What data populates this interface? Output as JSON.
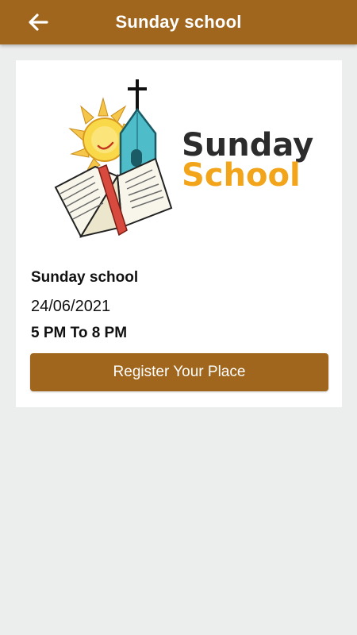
{
  "app_bar": {
    "title": "Sunday school",
    "back_icon": "arrow-left-icon"
  },
  "event": {
    "image": {
      "logo_line1": "Sunday",
      "logo_line2": "School",
      "logo_line1_color": "#2c2c2c",
      "logo_line2_color": "#f2a51a"
    },
    "name": "Sunday school",
    "date": "24/06/2021",
    "time": "5 PM To 8 PM",
    "register_label": "Register Your Place"
  },
  "colors": {
    "primary": "#a0661d",
    "background": "#eceded",
    "card": "#ffffff"
  }
}
